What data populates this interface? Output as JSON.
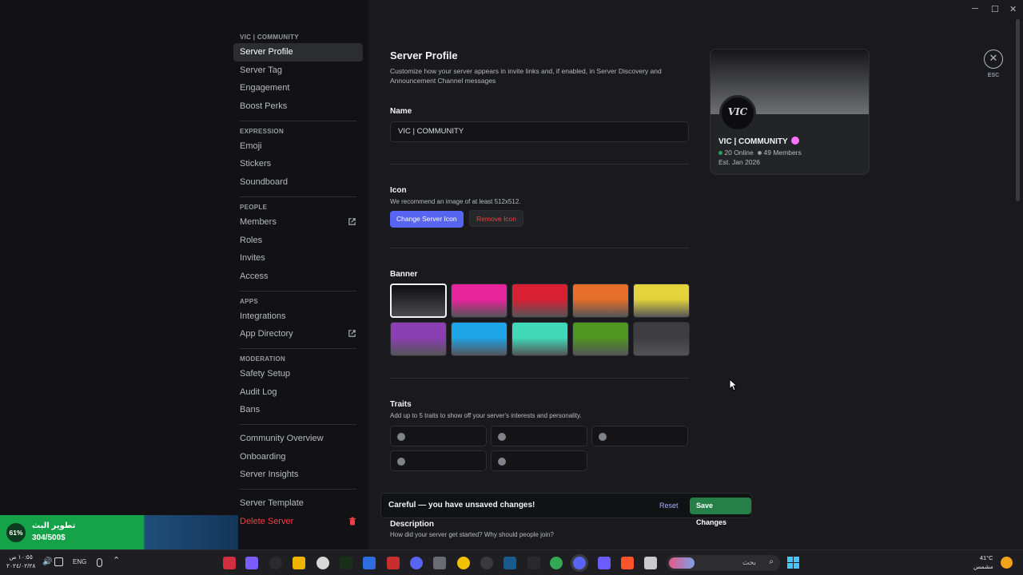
{
  "window": {
    "minimize": "─",
    "maximize": "☐",
    "close": "✕"
  },
  "sidebar": {
    "server_header": "VIC | COMMUNITY",
    "items_top": [
      {
        "label": "Server Profile",
        "active": true
      },
      {
        "label": "Server Tag"
      },
      {
        "label": "Engagement"
      },
      {
        "label": "Boost Perks"
      }
    ],
    "expression_header": "EXPRESSION",
    "expression_items": [
      "Emoji",
      "Stickers",
      "Soundboard"
    ],
    "people_header": "PEOPLE",
    "people_items": [
      "Members",
      "Roles",
      "Invites",
      "Access"
    ],
    "apps_header": "APPS",
    "apps_items": [
      "Integrations",
      "App Directory"
    ],
    "moderation_header": "MODERATION",
    "moderation_items": [
      "Safety Setup",
      "Audit Log",
      "Bans"
    ],
    "community_items": [
      "Community Overview",
      "Onboarding",
      "Server Insights"
    ],
    "template_item": "Server Template",
    "delete_item": "Delete Server"
  },
  "main": {
    "title": "Server Profile",
    "subtitle": "Customize how your server appears in invite links and, if enabled, in Server Discovery and Announcement Channel messages",
    "name_label": "Name",
    "name_value": "VIC | COMMUNITY",
    "icon_label": "Icon",
    "icon_hint": "We recommend an image of at least 512x512.",
    "change_icon_button": "Change Server Icon",
    "remove_icon_button": "Remove Icon",
    "banner_label": "Banner",
    "banner_colors": [
      "#1c1c1f",
      "#e8249a",
      "#d91f32",
      "#e66f2a",
      "#e3d43b",
      "#8b3fb3",
      "#1ea4e8",
      "#3fd9b8",
      "#4f9620",
      "#3e3e42"
    ],
    "banner_selected": 0,
    "traits_label": "Traits",
    "traits_hint": "Add up to 5 traits to show off your server's interests and personality.",
    "description_label": "Description",
    "description_hint": "How did your server get started? Why should people join?"
  },
  "preview": {
    "name": "VIC | COMMUNITY",
    "online": "20 Online",
    "members": "49 Members",
    "established": "Est. Jan 2026",
    "avatar_text": "VIC"
  },
  "close": {
    "label": "ESC"
  },
  "toast": {
    "message": "Careful — you have unsaved changes!",
    "reset": "Reset",
    "save": "Save Changes"
  },
  "widget": {
    "percent": "61%",
    "title": "تطوير البث",
    "amount": "304/500$"
  },
  "taskbar": {
    "time": "١٠:٥٥ ص",
    "date": "٢٠٢٤/٠٢/٢٨",
    "lang": "ENG",
    "search_placeholder": "بحث",
    "weather_temp": "41°C",
    "weather_desc": "مشمس"
  }
}
